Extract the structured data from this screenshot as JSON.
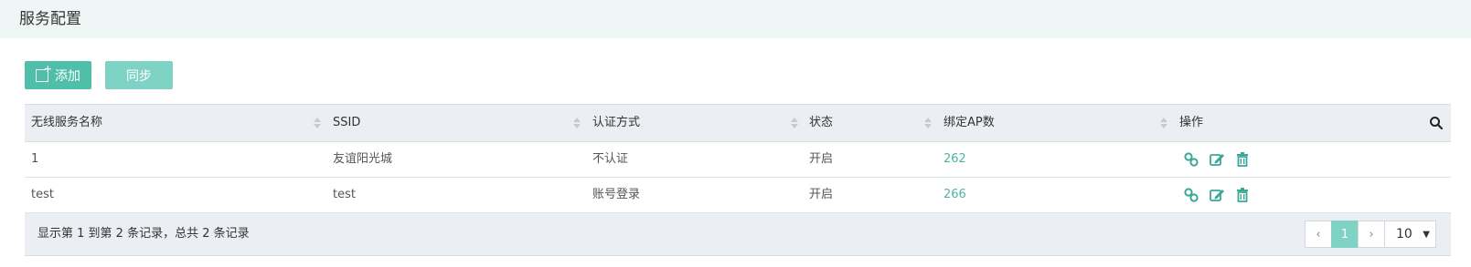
{
  "page": {
    "title": "服务配置"
  },
  "toolbar": {
    "add_label": "添加",
    "sync_label": "同步"
  },
  "table": {
    "columns": [
      "无线服务名称",
      "SSID",
      "认证方式",
      "状态",
      "绑定AP数",
      "操作"
    ],
    "rows": [
      {
        "name": "1",
        "ssid": "友谊阳光城",
        "auth": "不认证",
        "status": "开启",
        "ap_count": "262"
      },
      {
        "name": "test",
        "ssid": "test",
        "auth": "账号登录",
        "status": "开启",
        "ap_count": "266"
      }
    ],
    "summary": "显示第 1 到第 2 条记录，总共 2 条记录"
  },
  "pagination": {
    "prev": "‹",
    "current": "1",
    "next": "›",
    "page_size": "10"
  },
  "colors": {
    "accent": "#4fbfaa",
    "accent_light": "#7fd3c4",
    "header_bg": "#eef7f5",
    "table_header_bg": "#ebeef2",
    "link": "#4fb3a6"
  },
  "icons": [
    "add-box-icon",
    "sort-icon",
    "search-icon",
    "link-icon",
    "edit-icon",
    "trash-icon",
    "caret-down-icon"
  ]
}
